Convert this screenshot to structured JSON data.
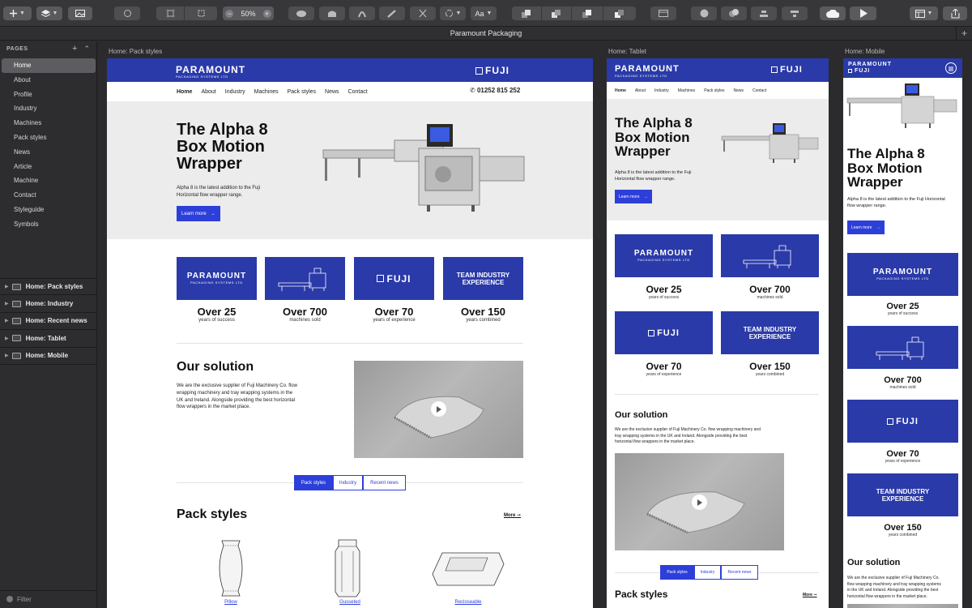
{
  "app": {
    "document_title": "Paramount Packaging",
    "zoom": "50%",
    "text_tool": "Aa"
  },
  "sidebar": {
    "header": "PAGES",
    "pages": [
      "Home",
      "About",
      "Profile",
      "Industry",
      "Machines",
      "Pack styles",
      "News",
      "Article",
      "Machine",
      "Contact",
      "Styleguide",
      "Symbols"
    ],
    "active_page": "Home",
    "artboards": [
      "Home: Pack styles",
      "Home: Industry",
      "Home: Recent news",
      "Home: Tablet",
      "Home: Mobile"
    ],
    "filter": "Filter"
  },
  "artboard_labels": {
    "desktop": "Home: Pack styles",
    "tablet": "Home: Tablet",
    "mobile": "Home: Mobile"
  },
  "site": {
    "brand": "PARAMOUNT",
    "brand_sub": "PACKAGING SYSTEMS LTD",
    "partner": "FUJI",
    "nav": [
      "Home",
      "About",
      "Industry",
      "Machines",
      "Pack styles",
      "News",
      "Contact"
    ],
    "phone": "01252 815 252",
    "hero_title_lines": [
      "The Alpha 8",
      "Box Motion",
      "Wrapper"
    ],
    "hero_text": "Alpha 8 is the latest addition to the Fuji Horizontal flow wrapper range.",
    "hero_text_desktop_lines": [
      "Alpha 8 is the latest addition to the Fuji",
      "Horizontal flow wrapper range."
    ],
    "cta": "Learn more",
    "tile_team": [
      "TEAM INDUSTRY",
      "EXPERIENCE"
    ],
    "stats": [
      {
        "value": "Over 25",
        "caption": "years of success"
      },
      {
        "value": "Over 700",
        "caption": "machines sold"
      },
      {
        "value": "Over 70",
        "caption": "years of experience"
      },
      {
        "value": "Over 150",
        "caption": "years combined"
      }
    ],
    "solution_title": "Our solution",
    "solution_desktop_lines": [
      "We are the exclusive supplier of Fuji Machinery Co. flow",
      "wrapping machinery and tray wrapping systems in the",
      "UK and Ireland. Alongside providing the best horizontal",
      "flow wrappers in the market place."
    ],
    "solution_tablet_lines": [
      "We are the exclusive supplier of Fuji Machinery Co. flow wrapping machinery and",
      "tray wrapping systems in the UK and Ireland. Alongside providing the best",
      "horizontal flow wrappers in the market place."
    ],
    "solution_mobile_lines": [
      "We are the exclusive supplier of Fuji Machinery Co.",
      "flow wrapping machinery and tray wrapping systems",
      "in the UK and Ireland. Alongside providing the best",
      "horizontal flow wrappers in the market place."
    ],
    "tabs": [
      "Pack styles",
      "Industry",
      "Recent news"
    ],
    "active_tab": "Pack styles",
    "pack_title": "Pack styles",
    "more": "More",
    "packs": [
      "Pillow",
      "Gusseted",
      "Recloseable"
    ]
  }
}
